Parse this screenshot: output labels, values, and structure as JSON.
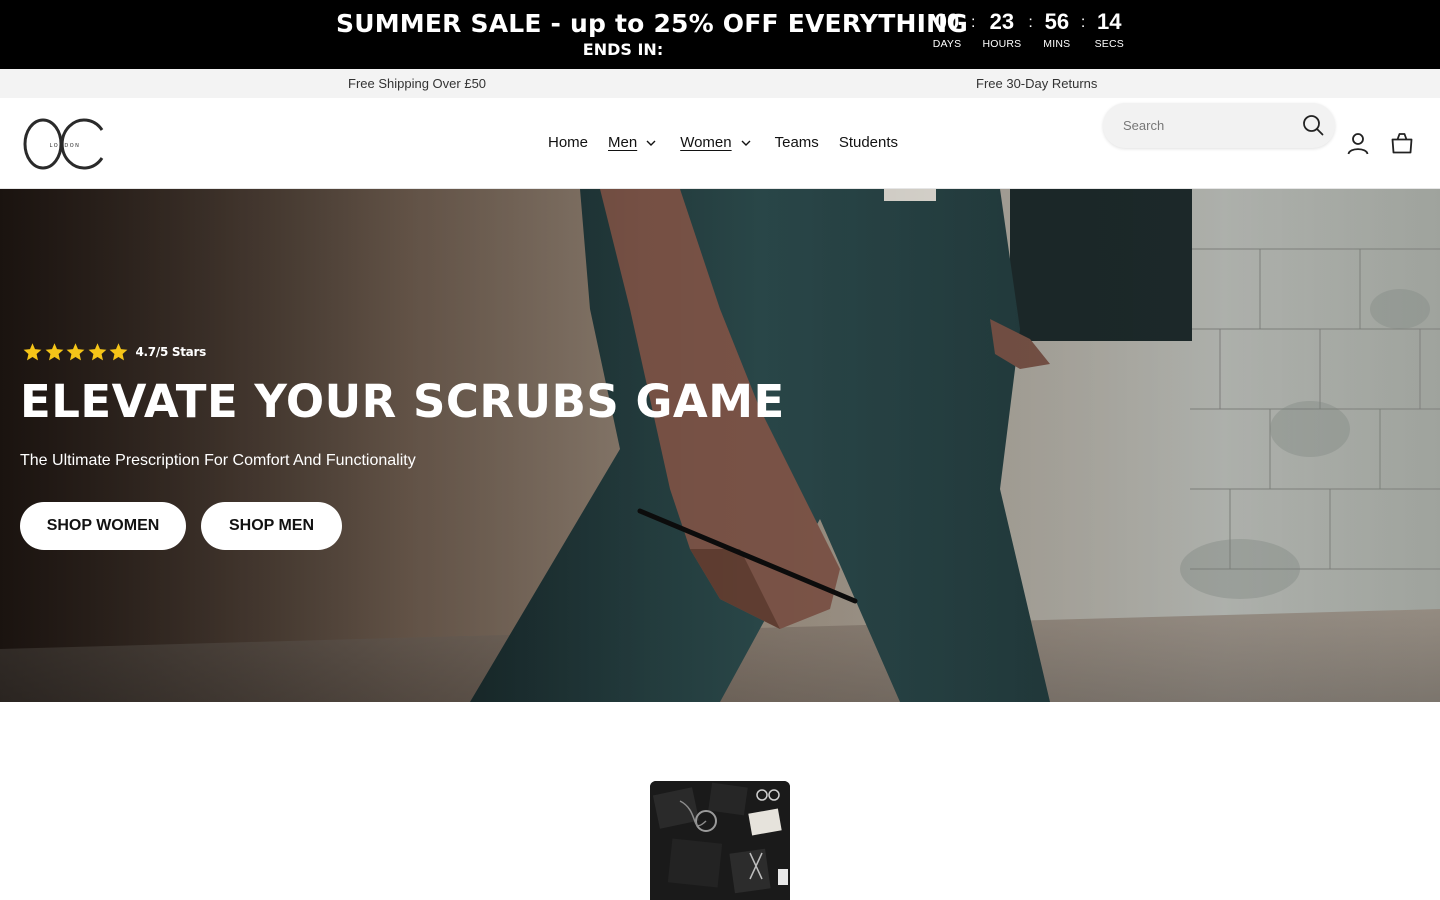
{
  "announcement": {
    "title": "SUMMER SALE - up to 25% OFF EVERYTHING",
    "subtitle": "ENDS IN:",
    "countdown": [
      {
        "value": "00",
        "label": "DAYS"
      },
      {
        "value": "23",
        "label": "HOURS"
      },
      {
        "value": "56",
        "label": "MINS"
      },
      {
        "value": "14",
        "label": "SECS"
      }
    ],
    "separator": ":"
  },
  "usp": {
    "left": "Free Shipping Over £50",
    "right": "Free 30-Day Returns"
  },
  "header": {
    "logo_mark": "OC",
    "logo_text": "LONDON",
    "nav": [
      {
        "label": "Home",
        "has_dropdown": false
      },
      {
        "label": "Men",
        "has_dropdown": true
      },
      {
        "label": "Women",
        "has_dropdown": true
      },
      {
        "label": "Teams",
        "has_dropdown": false
      },
      {
        "label": "Students",
        "has_dropdown": false
      }
    ],
    "search_placeholder": "Search",
    "icons": [
      "search-icon",
      "account-icon",
      "cart-icon"
    ]
  },
  "hero": {
    "rating_stars": 5,
    "rating_text": "4.7/5 Stars",
    "title": "ELEVATE YOUR SCRUBS GAME",
    "subtitle": "The Ultimate Prescription For Comfort And Functionality",
    "buttons": {
      "shop_women": "SHOP WOMEN",
      "shop_men": "SHOP MEN"
    }
  },
  "colors": {
    "announcement_bg": "#000000",
    "usp_bg": "#f3f3f3",
    "star": "#f5c518",
    "scrub_teal": "#2c4a4c"
  }
}
